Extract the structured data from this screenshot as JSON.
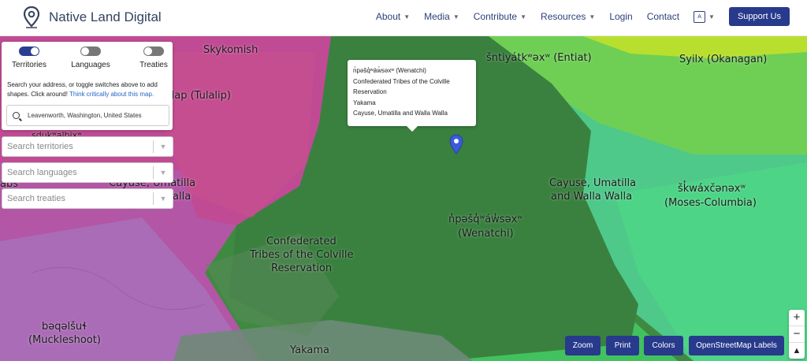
{
  "header": {
    "brand": "Native Land Digital",
    "nav": [
      {
        "label": "About",
        "has_dropdown": true
      },
      {
        "label": "Media",
        "has_dropdown": true
      },
      {
        "label": "Contribute",
        "has_dropdown": true
      },
      {
        "label": "Resources",
        "has_dropdown": true
      },
      {
        "label": "Login",
        "has_dropdown": false
      },
      {
        "label": "Contact",
        "has_dropdown": false
      }
    ],
    "language_icon": "translate-icon",
    "support_label": "Support Us"
  },
  "panel": {
    "toggles": [
      {
        "label": "Territories",
        "on": true
      },
      {
        "label": "Languages",
        "on": false
      },
      {
        "label": "Treaties",
        "on": false
      }
    ],
    "instructions": "Search your address, or toggle switches above to add shapes. Click around!",
    "link_text": "Think critically about this map.",
    "address_value": "Leavenworth, Washington, United States"
  },
  "searches": {
    "territories": "Search territories",
    "languages": "Search languages",
    "treaties": "Search treaties"
  },
  "popup": {
    "lines": [
      "n̓pəšq̓ʷáw̓səxʷ (Wenatchi)",
      "Confederated Tribes of the Colville",
      "Reservation",
      "Yakama",
      "Cayuse, Umatilla and Walla Walla"
    ]
  },
  "map_labels": {
    "skykomish": "Skykomish",
    "entiat": "šntiyátkʷəxʷ (Entiat)",
    "syilx": "Syilx (Okanagan)",
    "tulalip": "ilap (Tulalip)",
    "sduk": "sdukʷalbixʷ",
    "cayuse_left_1": "Cayuse, Umatilla",
    "cayuse_left_2": "Walla",
    "abs": "abs",
    "cayuse_right_1": "Cayuse, Umatilla",
    "cayuse_right_2": "and Walla Walla",
    "moses_1": "šk̓wáxčənəxʷ",
    "moses_2": "(Moses-Columbia)",
    "wenatchi_1": "n̓pəšq̓ʷáw̓səxʷ",
    "wenatchi_2": "(Wenatchi)",
    "colville_1": "Confederated",
    "colville_2": "Tribes of the Colville",
    "colville_3": "Reservation",
    "muckle_1": "bəqəlšuɬ",
    "muckle_2": "(Muckleshoot)",
    "yakama": "Yakama"
  },
  "map_colors": {
    "purple": "#b356a6",
    "magenta": "#c04b94",
    "green_dark": "#3f8a41",
    "green_mid": "#4cb05a",
    "green_light": "#7bd24b",
    "teal": "#4ec98a",
    "yellow_green": "#b8df2d",
    "grey": "#6e8a78"
  },
  "bottom_buttons": {
    "zoom": "Zoom",
    "print": "Print",
    "colors": "Colors",
    "osm": "OpenStreetMap Labels"
  },
  "zoom_controls": {
    "plus": "+",
    "minus": "−",
    "north": "▲"
  }
}
